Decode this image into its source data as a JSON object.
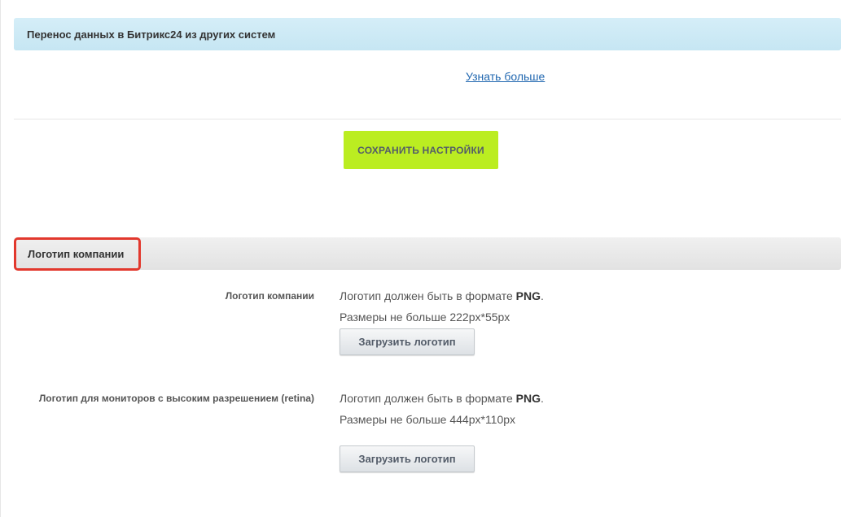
{
  "migration_section": {
    "title": "Перенос данных в Битрикс24 из других систем",
    "learn_more_link": "Узнать больше"
  },
  "save_button": {
    "label": "СОХРАНИТЬ НАСТРОЙКИ",
    "color": "#bbed21"
  },
  "logo_section": {
    "title": "Логотип компании",
    "highlight_color": "#e2382d",
    "rows": [
      {
        "label": "Логотип компании",
        "format_prefix": "Логотип должен быть в формате ",
        "format_value": "PNG",
        "format_suffix": ".",
        "size_text": "Размеры не больше 222px*55px",
        "button_label": "Загрузить логотип"
      },
      {
        "label": "Логотип для мониторов с высоким разрешением (retina)",
        "format_prefix": "Логотип должен быть в формате ",
        "format_value": "PNG",
        "format_suffix": ".",
        "size_text": "Размеры не больше 444px*110px",
        "button_label": "Загрузить логотип"
      }
    ]
  }
}
